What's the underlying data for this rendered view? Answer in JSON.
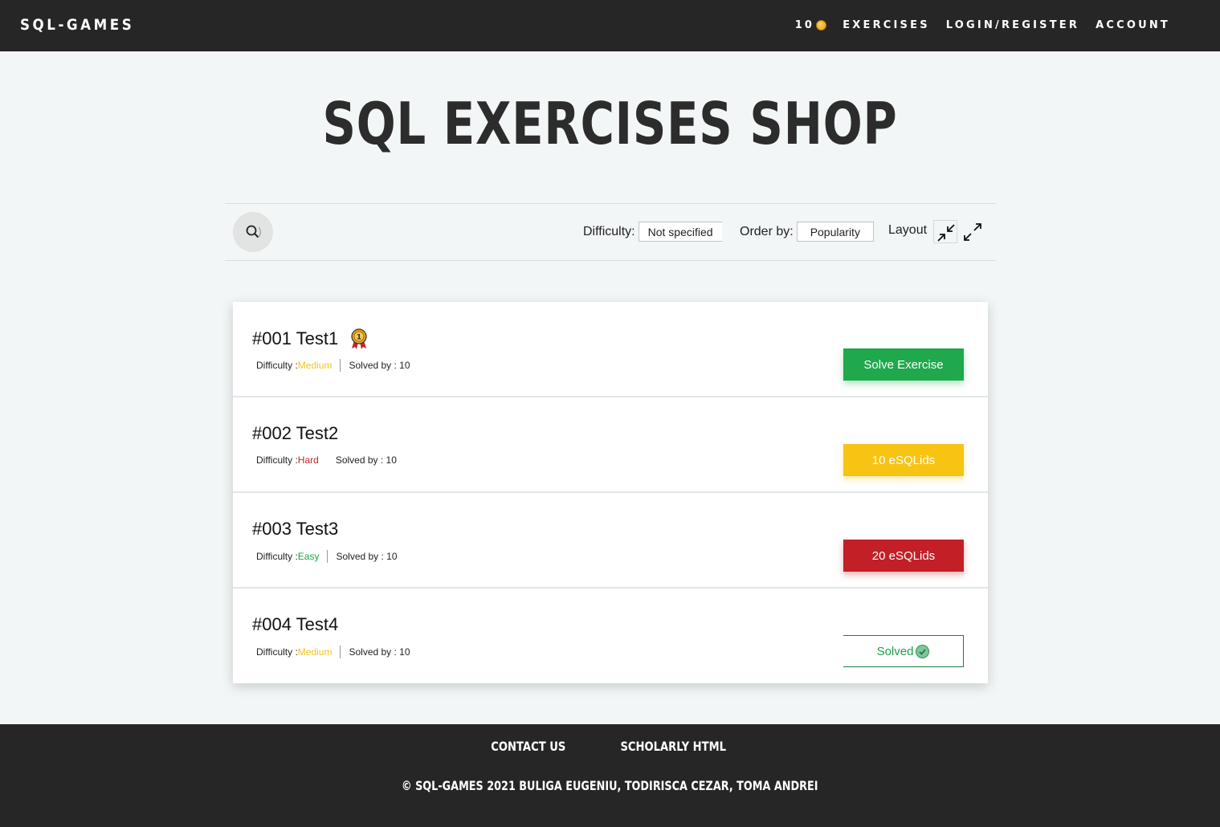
{
  "navbar": {
    "brand": "SQL-GAMES",
    "coins": "10",
    "coin_icon": "coin-icon",
    "links": [
      "EXERCISES",
      "LOGIN/REGISTER",
      "ACCOUNT"
    ]
  },
  "page": {
    "title": "SQL EXERCISES SHOP"
  },
  "filters": {
    "search_icon": "search-icon",
    "difficulty_label": "Difficulty:",
    "difficulty_value": "Not specified",
    "order_label": "Order by:",
    "order_value": "Popularity",
    "layout_label": "Layout",
    "layout_icons": [
      "collapse-icon",
      "expand-icon"
    ]
  },
  "exercises": [
    {
      "title": "#001 Test1",
      "has_medal": true,
      "difficulty_label": "Difficulty : ",
      "difficulty": "Medium",
      "difficulty_color": "#f5c518",
      "solved_by": "Solved by : 10",
      "action": "Solve Exercise",
      "action_style": "green"
    },
    {
      "title": "#002 Test2",
      "has_medal": false,
      "difficulty_label": "Difficulty : ",
      "difficulty": "Hard",
      "difficulty_color": "#c0262c",
      "solved_by": "Solved by : 10",
      "action": "10 eSQLids",
      "action_style": "yellow"
    },
    {
      "title": "#003 Test3",
      "has_medal": false,
      "difficulty_label": "Difficulty : ",
      "difficulty": "Easy",
      "difficulty_color": "#1e9e48",
      "solved_by": "Solved by : 10",
      "action": "20 eSQLids",
      "action_style": "red"
    },
    {
      "title": "#004 Test4",
      "has_medal": false,
      "difficulty_label": "Difficulty : ",
      "difficulty": "Medium",
      "difficulty_color": "#f5c518",
      "solved_by": "Solved by : 10",
      "action": "Solved",
      "action_style": "solved"
    }
  ],
  "footer": {
    "links": [
      "CONTACT US",
      "SCHOLARLY HTML"
    ],
    "copyright": "© SQL-GAMES 2021 BULIGA EUGENIU, TODIRISCA CEZAR, TOMA ANDREI"
  }
}
